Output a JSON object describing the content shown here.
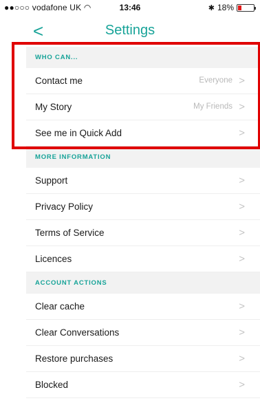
{
  "status_bar": {
    "carrier": "●●○○○ vodafone UK",
    "wifi_icon": "wifi-icon",
    "time": "13:46",
    "bluetooth_icon": "bluetooth-icon",
    "battery": "18%"
  },
  "nav": {
    "back_glyph": "<",
    "title": "Settings"
  },
  "sections": [
    {
      "header": "WHO CAN...",
      "rows": [
        {
          "label": "Contact me",
          "value": "Everyone"
        },
        {
          "label": "My Story",
          "value": "My Friends"
        },
        {
          "label": "See me in Quick Add",
          "value": ""
        }
      ]
    },
    {
      "header": "MORE INFORMATION",
      "rows": [
        {
          "label": "Support",
          "value": ""
        },
        {
          "label": "Privacy Policy",
          "value": ""
        },
        {
          "label": "Terms of Service",
          "value": ""
        },
        {
          "label": "Licences",
          "value": ""
        }
      ]
    },
    {
      "header": "ACCOUNT ACTIONS",
      "rows": [
        {
          "label": "Clear cache",
          "value": ""
        },
        {
          "label": "Clear Conversations",
          "value": ""
        },
        {
          "label": "Restore purchases",
          "value": ""
        },
        {
          "label": "Blocked",
          "value": ""
        }
      ]
    }
  ],
  "chevron_glyph": ">",
  "colors": {
    "accent": "#17a398",
    "highlight": "#e00000",
    "battery_low": "#e21b1b"
  }
}
